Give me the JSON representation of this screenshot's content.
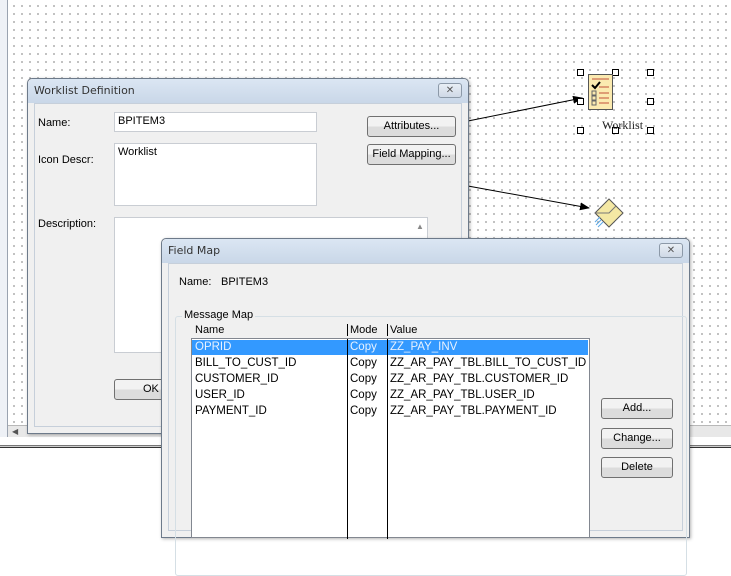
{
  "canvas": {
    "worklist_icon_label": "Worklist"
  },
  "worklist_dialog": {
    "title": "Worklist Definition",
    "name_label": "Name:",
    "name_value": "BPITEM3",
    "icon_descr_label": "Icon Descr:",
    "icon_descr_value": "Worklist",
    "description_label": "Description:",
    "description_value": "",
    "attributes_button": "Attributes...",
    "field_mapping_button": "Field Mapping...",
    "ok_button": "OK",
    "close_glyph": "✕"
  },
  "field_map_dialog": {
    "title": "Field Map",
    "name_label": "Name:",
    "name_value": "BPITEM3",
    "group_label": "Message Map",
    "columns": [
      "Name",
      "Mode",
      "Value"
    ],
    "rows": [
      {
        "name": "OPRID",
        "mode": "Copy",
        "value": "ZZ_PAY_INV",
        "selected": true
      },
      {
        "name": "BILL_TO_CUST_ID",
        "mode": "Copy",
        "value": "ZZ_AR_PAY_TBL.BILL_TO_CUST_ID"
      },
      {
        "name": "CUSTOMER_ID",
        "mode": "Copy",
        "value": "ZZ_AR_PAY_TBL.CUSTOMER_ID"
      },
      {
        "name": "USER_ID",
        "mode": "Copy",
        "value": "ZZ_AR_PAY_TBL.USER_ID"
      },
      {
        "name": "PAYMENT_ID",
        "mode": "Copy",
        "value": "ZZ_AR_PAY_TBL.PAYMENT_ID"
      }
    ],
    "add_button": "Add...",
    "change_button": "Change...",
    "delete_button": "Delete",
    "close_glyph": "✕"
  },
  "colors": {
    "selection": "#3399ff",
    "titlebar": "#c9d7e8"
  }
}
